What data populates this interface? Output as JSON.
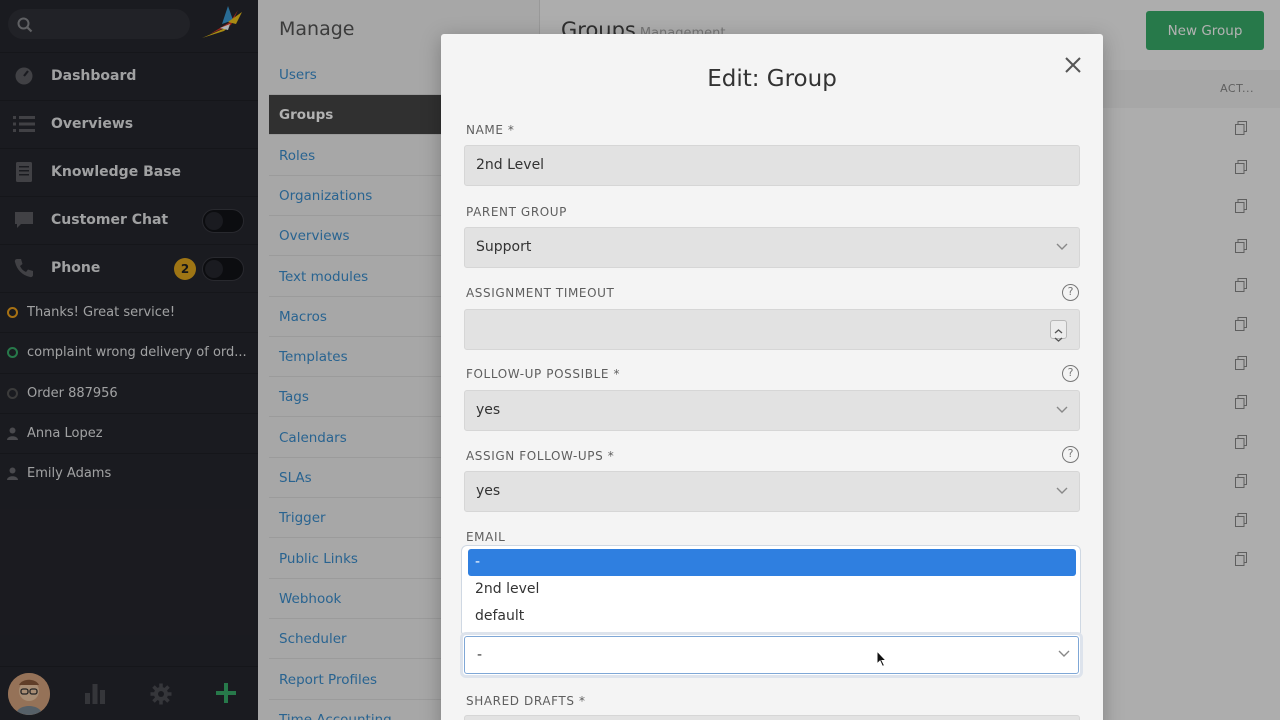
{
  "sidebar": {
    "nav": [
      {
        "label": "Dashboard",
        "icon": "dashboard-icon"
      },
      {
        "label": "Overviews",
        "icon": "list-icon"
      },
      {
        "label": "Knowledge Base",
        "icon": "book-icon"
      },
      {
        "label": "Customer Chat",
        "icon": "chat-icon"
      },
      {
        "label": "Phone",
        "icon": "phone-icon",
        "badge": "2"
      }
    ],
    "tasks": [
      {
        "label": "Thanks! Great service!",
        "status_color": "#f0a31c"
      },
      {
        "label": "complaint wrong delivery of ord...",
        "status_color": "#38ae6a"
      },
      {
        "label": "Order 887956",
        "status_color": "#555555"
      },
      {
        "label": "Anna Lopez",
        "icon": "person-icon"
      },
      {
        "label": "Emily Adams",
        "icon": "person-icon"
      }
    ]
  },
  "manage": {
    "title": "Manage",
    "items": [
      "Users",
      "Groups",
      "Roles",
      "Organizations",
      "Overviews",
      "Text modules",
      "Macros",
      "Templates",
      "Tags",
      "Calendars",
      "SLAs",
      "Trigger",
      "Public Links",
      "Webhook",
      "Scheduler",
      "Report Profiles",
      "Time Accounting"
    ],
    "active": "Groups"
  },
  "main": {
    "title": "Groups",
    "subtitle": "Management",
    "new_button": "New Group",
    "actions_header": "ACT..."
  },
  "modal": {
    "title": "Edit: Group",
    "fields": {
      "name": {
        "label": "NAME *",
        "value": "2nd Level"
      },
      "parent_group": {
        "label": "PARENT GROUP",
        "value": "Support"
      },
      "assignment_timeout": {
        "label": "ASSIGNMENT TIMEOUT",
        "value": ""
      },
      "follow_up_possible": {
        "label": "FOLLOW-UP POSSIBLE *",
        "value": "yes"
      },
      "assign_follow_ups": {
        "label": "ASSIGN FOLLOW-UPS *",
        "value": "yes"
      },
      "email": {
        "label": "EMAIL",
        "value": "-",
        "options": [
          "-",
          "2nd level",
          "default"
        ],
        "selected": "-"
      },
      "shared_drafts": {
        "label": "SHARED DRAFTS *"
      }
    }
  },
  "colors": {
    "accent": "#2f7fe0",
    "success": "#38ae6a",
    "link": "#3b8fcf",
    "sidebar": "#26272e"
  }
}
